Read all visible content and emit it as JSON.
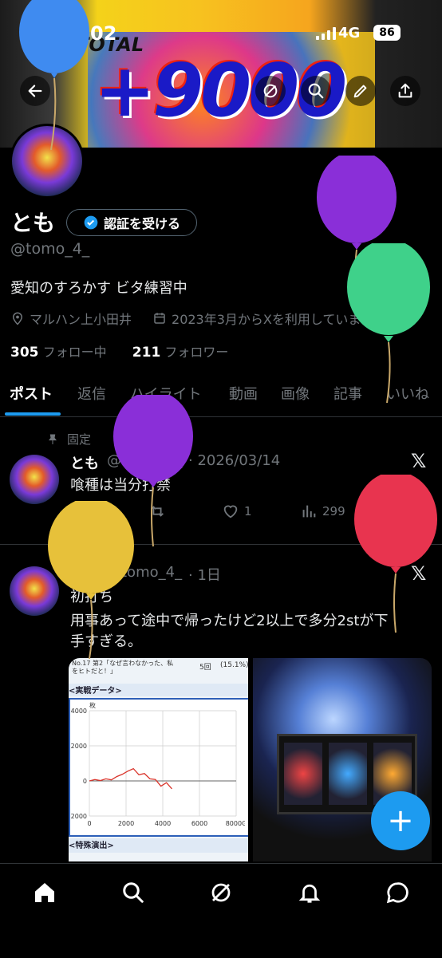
{
  "status_bar": {
    "time": "16:02",
    "network": "4G",
    "battery": "86"
  },
  "banner": {
    "label": "TOTAL",
    "big_text": "+9000"
  },
  "profile": {
    "name": "とも",
    "verify_button": "認証を受ける",
    "handle": "@tomo_4_",
    "bio": "愛知のすろかす ビタ練習中",
    "location": "マルハン上小田井",
    "joined": "2023年3月からXを利用しています",
    "following_count": "305",
    "following_label": "フォロー中",
    "followers_count": "211",
    "followers_label": "フォロワー"
  },
  "tabs": [
    "ポスト",
    "返信",
    "ハイライト",
    "動画",
    "画像",
    "記事",
    "いいね"
  ],
  "posts": [
    {
      "pinned_label": "固定",
      "name": "とも",
      "handle": "@tomo_4_",
      "date": "· 2026/03/14",
      "text": "喰種は当分打禁",
      "likes": "1",
      "views": "299"
    },
    {
      "name": "とも",
      "handle": "@tomo_4_",
      "date": "· 1日",
      "text_line1": "初打ち",
      "text_line2": "用事あって途中で帰ったけど2以上で多分2stが下",
      "text_line3": "手すぎる。",
      "image1": {
        "header_text": "No.17 第2「なぜ言わなかった、私をヒトだと！」",
        "header_count": "5回",
        "header_pct": "(15.1%)",
        "section_title": "<実戦データ>",
        "section2_title": "<特殊演出>",
        "chart_unit": "枚"
      }
    }
  ],
  "chart_data": {
    "type": "line",
    "title": "",
    "xlabel": "",
    "ylabel": "枚",
    "x": [
      0,
      300,
      600,
      900,
      1200,
      1500,
      1800,
      2100,
      2400,
      2700,
      3000,
      3300,
      3600,
      3900,
      4200,
      4500
    ],
    "series": [
      {
        "values": [
          0,
          80,
          20,
          120,
          60,
          250,
          380,
          560,
          700,
          350,
          420,
          120,
          80,
          -300,
          -100,
          -450
        ]
      }
    ],
    "xticks": [
      "0",
      "2000",
      "4000",
      "6000",
      "8000G"
    ],
    "yticks": [
      "4000",
      "2000",
      "0",
      "2000"
    ],
    "xlim": [
      0,
      8000
    ],
    "ylim": [
      -2000,
      4000
    ],
    "grid": true
  },
  "colors": {
    "accent": "#1d9bf0",
    "muted": "#71767b",
    "text": "#e7e9ea",
    "divider": "#2f3336"
  },
  "icons": {
    "back": "arrow-left-icon",
    "grok": "grok-icon",
    "search": "search-icon",
    "edit": "pencil-icon",
    "share": "share-icon",
    "location": "location-pin-icon",
    "calendar": "calendar-icon",
    "pin": "pin-icon",
    "reply": "reply-icon",
    "repost": "repost-icon",
    "like": "heart-icon",
    "views": "views-icon",
    "bookmark": "bookmark-icon",
    "home": "home-icon",
    "notifications": "bell-icon",
    "messages": "message-icon",
    "fab": "plus-icon"
  }
}
